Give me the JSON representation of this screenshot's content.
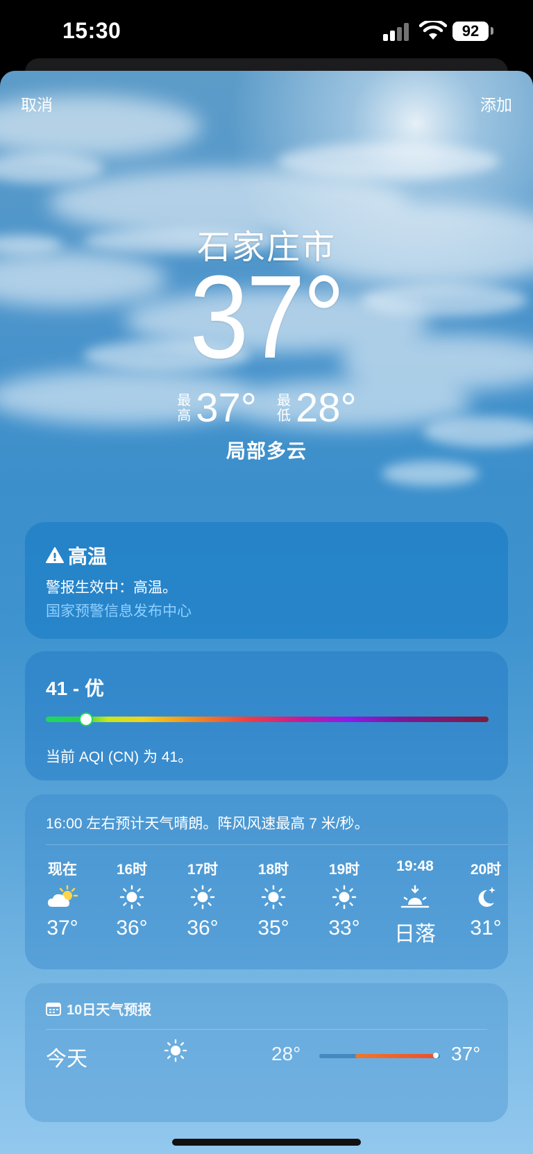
{
  "status_bar": {
    "time": "15:30",
    "battery": "92"
  },
  "nav": {
    "cancel_label": "取消",
    "add_label": "添加"
  },
  "weather": {
    "city": "石家庄市",
    "temperature": "37°",
    "high_label": "最高",
    "high_value": "37°",
    "low_label": "最低",
    "low_value": "28°",
    "condition": "局部多云"
  },
  "alert": {
    "title": "高温",
    "icon": "warning-triangle-icon",
    "message": "警报生效中：高温。",
    "source": "国家预警信息发布中心"
  },
  "aqi": {
    "value_label": "41 - 优",
    "level": 41,
    "description": "当前 AQI (CN) 为 41。"
  },
  "hourly": {
    "summary": "16:00 左右预计天气晴朗。阵风风速最高 7 米/秒。",
    "items": [
      {
        "label": "现在",
        "icon": "partly-cloudy-sun-icon",
        "temp": "37°"
      },
      {
        "label": "16时",
        "icon": "sun-icon",
        "temp": "36°"
      },
      {
        "label": "17时",
        "icon": "sun-icon",
        "temp": "36°"
      },
      {
        "label": "18时",
        "icon": "sun-icon",
        "temp": "35°"
      },
      {
        "label": "19时",
        "icon": "sun-icon",
        "temp": "33°"
      },
      {
        "label": "19:48",
        "icon": "sunset-icon",
        "temp": "日落"
      },
      {
        "label": "20时",
        "icon": "moon-stars-icon",
        "temp": "31°"
      }
    ]
  },
  "forecast": {
    "title": "10日天气预报",
    "icon": "calendar-icon",
    "days": [
      {
        "day": "今天",
        "icon": "sun-icon",
        "low": "28°",
        "high": "37°"
      }
    ]
  },
  "colors": {
    "alert_link": "#8fd0ff",
    "temp_range": "#f04e2a",
    "aqi_good": "#1ed760"
  }
}
